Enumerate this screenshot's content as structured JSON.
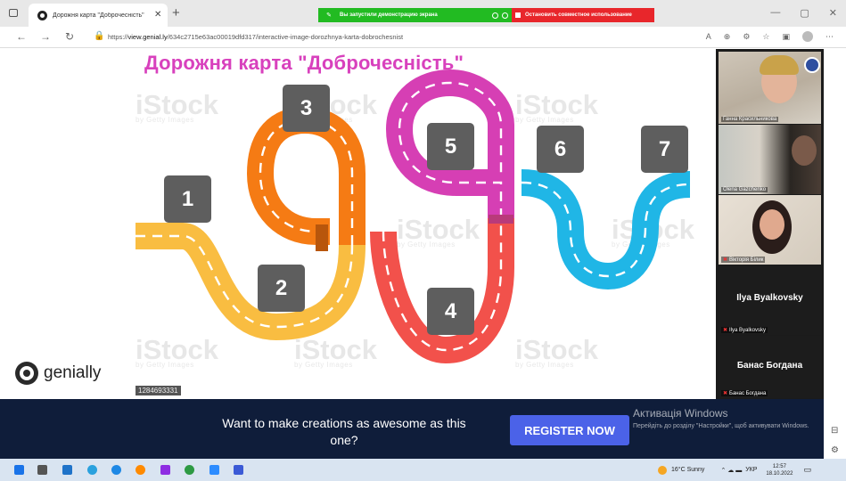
{
  "browser": {
    "tab_title": "Дорожня карта \"Доброчесність\"",
    "url_host": "view.genial.ly",
    "url_prefix": "https://",
    "url_path": "/634c2715e63ac00019dfd317/interactive-image-dorozhnya-karta-dobrochesnist"
  },
  "share_bar": {
    "status_label": "Вы запустили демонстрацию экрана",
    "stop_label": "Остановить совместное использование"
  },
  "content": {
    "title": "Дорожня карта \"Доброчесність\"",
    "watermark_main": "iStock",
    "watermark_sub": "by Getty Images",
    "image_id": "1284693331",
    "road_numbers": [
      "1",
      "2",
      "3",
      "4",
      "5",
      "6",
      "7"
    ],
    "road_colors": {
      "yellow": "#f9bd41",
      "orange": "#f57b14",
      "red": "#f2514b",
      "magenta": "#d63fb4",
      "blue": "#20b6e6"
    },
    "logo_text": "genially"
  },
  "participants": [
    {
      "name": "Ганна Красильникова"
    },
    {
      "name": "Olena Gazchenko"
    },
    {
      "name": "Вікторія Білик"
    },
    {
      "name": "Ilya Byalkovsky",
      "label": "Ilya Byalkovsky"
    },
    {
      "name": "Банас Богдана",
      "label": "Банас Богдана"
    }
  ],
  "banner": {
    "line1": "Want to make creations as awesome as this",
    "line2": "one?",
    "register_label": "REGISTER NOW",
    "activation_title": "Активація Windows",
    "activation_text": "Перейдіть до розділу \"Настройки\", щоб активувати Windows."
  },
  "taskbar": {
    "weather": "16°C  Sunny",
    "lang": "УКР",
    "time": "12:57",
    "date": "18.10.2022"
  }
}
